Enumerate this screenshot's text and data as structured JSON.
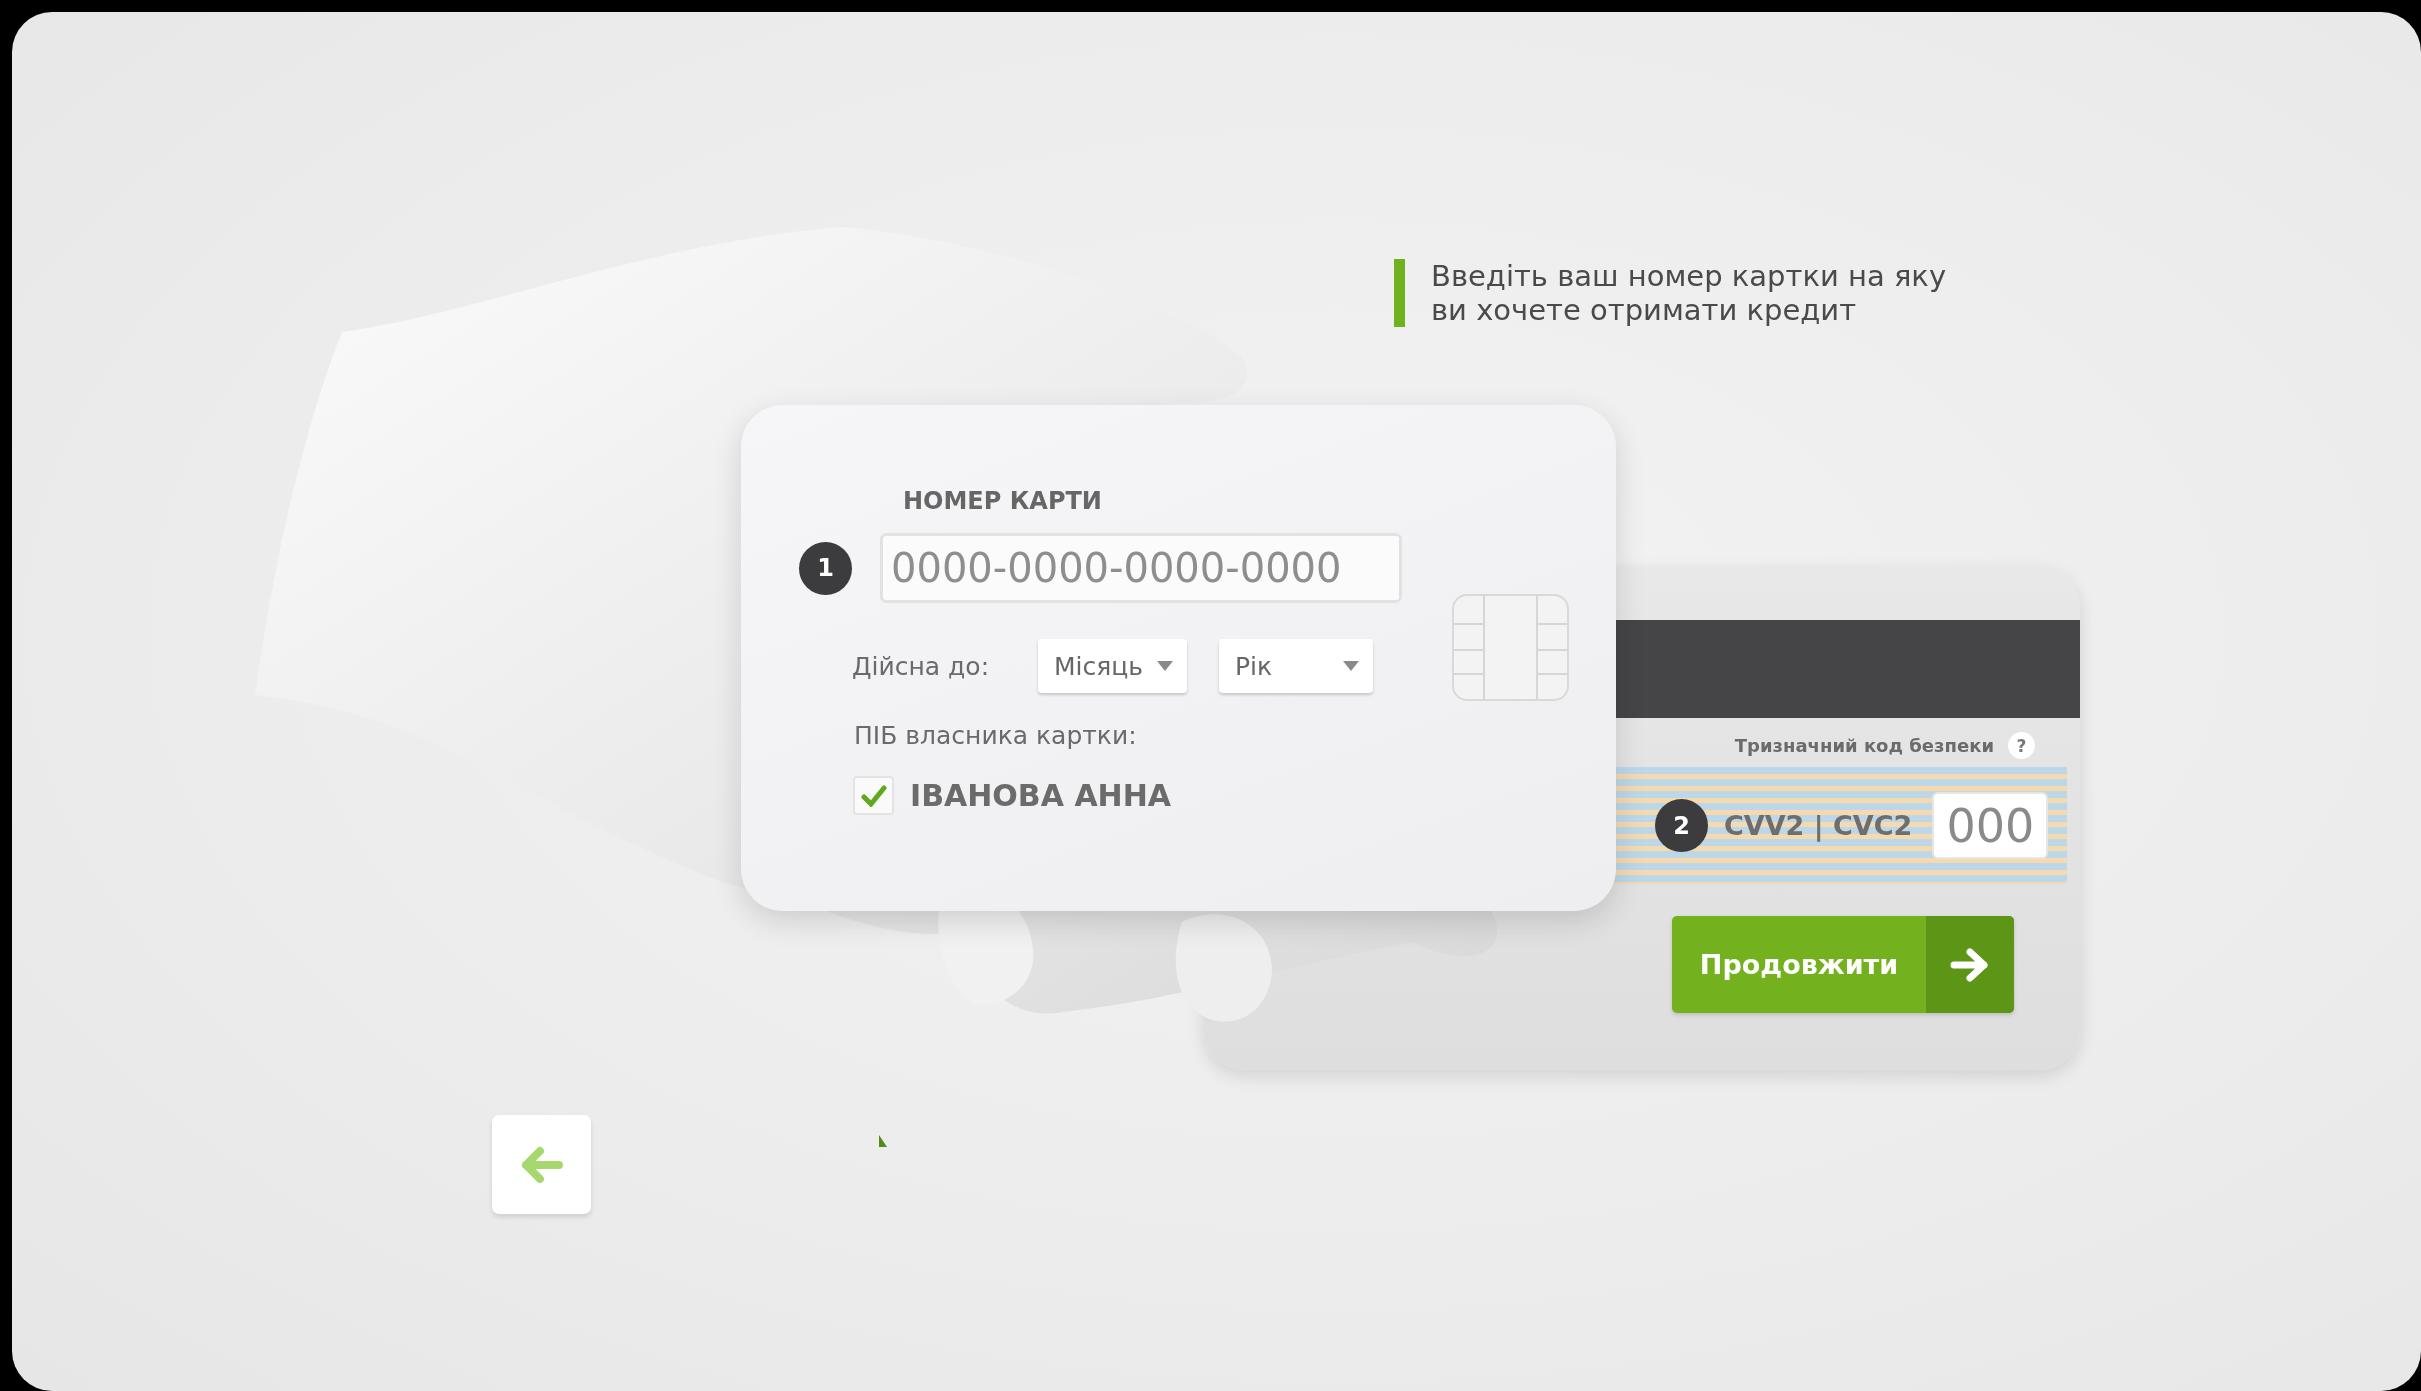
{
  "instruction": {
    "text": "Введіть ваш номер картки на яку\nви хочете отримати кредит"
  },
  "front_card": {
    "label": "НОМЕР КАРТИ",
    "step": "1",
    "card_number": {
      "placeholder": "0000-0000-0000-0000"
    },
    "expiry_label": "Дійсна до:",
    "expiry_selects": [
      {
        "value": "Місяць"
      },
      {
        "value": "Рік"
      }
    ],
    "holder_label": "ПІБ власника картки:",
    "holder": {
      "name": "ІВАНОВА АННА",
      "checked": true
    }
  },
  "back_card": {
    "security_label": "Тризначний код безпеки",
    "help": "?",
    "step": "2",
    "cvv_label": "CVV2 | CVC2",
    "cvv": {
      "placeholder": "000"
    },
    "continue_button": {
      "label": "Продовжити"
    }
  }
}
